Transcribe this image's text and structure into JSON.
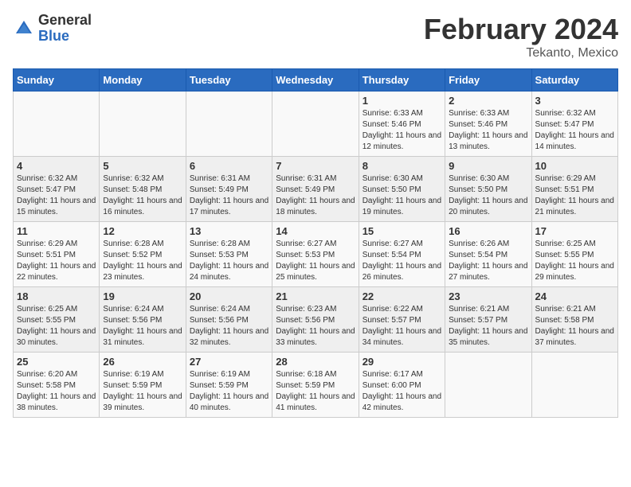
{
  "header": {
    "logo_general": "General",
    "logo_blue": "Blue",
    "title": "February 2024",
    "subtitle": "Tekanto, Mexico"
  },
  "days_of_week": [
    "Sunday",
    "Monday",
    "Tuesday",
    "Wednesday",
    "Thursday",
    "Friday",
    "Saturday"
  ],
  "weeks": [
    [
      {
        "day": "",
        "sunrise": "",
        "sunset": "",
        "daylight": ""
      },
      {
        "day": "",
        "sunrise": "",
        "sunset": "",
        "daylight": ""
      },
      {
        "day": "",
        "sunrise": "",
        "sunset": "",
        "daylight": ""
      },
      {
        "day": "",
        "sunrise": "",
        "sunset": "",
        "daylight": ""
      },
      {
        "day": "1",
        "sunrise": "6:33 AM",
        "sunset": "5:46 PM",
        "daylight": "11 hours and 12 minutes."
      },
      {
        "day": "2",
        "sunrise": "6:33 AM",
        "sunset": "5:46 PM",
        "daylight": "11 hours and 13 minutes."
      },
      {
        "day": "3",
        "sunrise": "6:32 AM",
        "sunset": "5:47 PM",
        "daylight": "11 hours and 14 minutes."
      }
    ],
    [
      {
        "day": "4",
        "sunrise": "6:32 AM",
        "sunset": "5:47 PM",
        "daylight": "11 hours and 15 minutes."
      },
      {
        "day": "5",
        "sunrise": "6:32 AM",
        "sunset": "5:48 PM",
        "daylight": "11 hours and 16 minutes."
      },
      {
        "day": "6",
        "sunrise": "6:31 AM",
        "sunset": "5:49 PM",
        "daylight": "11 hours and 17 minutes."
      },
      {
        "day": "7",
        "sunrise": "6:31 AM",
        "sunset": "5:49 PM",
        "daylight": "11 hours and 18 minutes."
      },
      {
        "day": "8",
        "sunrise": "6:30 AM",
        "sunset": "5:50 PM",
        "daylight": "11 hours and 19 minutes."
      },
      {
        "day": "9",
        "sunrise": "6:30 AM",
        "sunset": "5:50 PM",
        "daylight": "11 hours and 20 minutes."
      },
      {
        "day": "10",
        "sunrise": "6:29 AM",
        "sunset": "5:51 PM",
        "daylight": "11 hours and 21 minutes."
      }
    ],
    [
      {
        "day": "11",
        "sunrise": "6:29 AM",
        "sunset": "5:51 PM",
        "daylight": "11 hours and 22 minutes."
      },
      {
        "day": "12",
        "sunrise": "6:28 AM",
        "sunset": "5:52 PM",
        "daylight": "11 hours and 23 minutes."
      },
      {
        "day": "13",
        "sunrise": "6:28 AM",
        "sunset": "5:53 PM",
        "daylight": "11 hours and 24 minutes."
      },
      {
        "day": "14",
        "sunrise": "6:27 AM",
        "sunset": "5:53 PM",
        "daylight": "11 hours and 25 minutes."
      },
      {
        "day": "15",
        "sunrise": "6:27 AM",
        "sunset": "5:54 PM",
        "daylight": "11 hours and 26 minutes."
      },
      {
        "day": "16",
        "sunrise": "6:26 AM",
        "sunset": "5:54 PM",
        "daylight": "11 hours and 27 minutes."
      },
      {
        "day": "17",
        "sunrise": "6:25 AM",
        "sunset": "5:55 PM",
        "daylight": "11 hours and 29 minutes."
      }
    ],
    [
      {
        "day": "18",
        "sunrise": "6:25 AM",
        "sunset": "5:55 PM",
        "daylight": "11 hours and 30 minutes."
      },
      {
        "day": "19",
        "sunrise": "6:24 AM",
        "sunset": "5:56 PM",
        "daylight": "11 hours and 31 minutes."
      },
      {
        "day": "20",
        "sunrise": "6:24 AM",
        "sunset": "5:56 PM",
        "daylight": "11 hours and 32 minutes."
      },
      {
        "day": "21",
        "sunrise": "6:23 AM",
        "sunset": "5:56 PM",
        "daylight": "11 hours and 33 minutes."
      },
      {
        "day": "22",
        "sunrise": "6:22 AM",
        "sunset": "5:57 PM",
        "daylight": "11 hours and 34 minutes."
      },
      {
        "day": "23",
        "sunrise": "6:21 AM",
        "sunset": "5:57 PM",
        "daylight": "11 hours and 35 minutes."
      },
      {
        "day": "24",
        "sunrise": "6:21 AM",
        "sunset": "5:58 PM",
        "daylight": "11 hours and 37 minutes."
      }
    ],
    [
      {
        "day": "25",
        "sunrise": "6:20 AM",
        "sunset": "5:58 PM",
        "daylight": "11 hours and 38 minutes."
      },
      {
        "day": "26",
        "sunrise": "6:19 AM",
        "sunset": "5:59 PM",
        "daylight": "11 hours and 39 minutes."
      },
      {
        "day": "27",
        "sunrise": "6:19 AM",
        "sunset": "5:59 PM",
        "daylight": "11 hours and 40 minutes."
      },
      {
        "day": "28",
        "sunrise": "6:18 AM",
        "sunset": "5:59 PM",
        "daylight": "11 hours and 41 minutes."
      },
      {
        "day": "29",
        "sunrise": "6:17 AM",
        "sunset": "6:00 PM",
        "daylight": "11 hours and 42 minutes."
      },
      {
        "day": "",
        "sunrise": "",
        "sunset": "",
        "daylight": ""
      },
      {
        "day": "",
        "sunrise": "",
        "sunset": "",
        "daylight": ""
      }
    ]
  ],
  "labels": {
    "sunrise": "Sunrise:",
    "sunset": "Sunset:",
    "daylight": "Daylight hours"
  }
}
